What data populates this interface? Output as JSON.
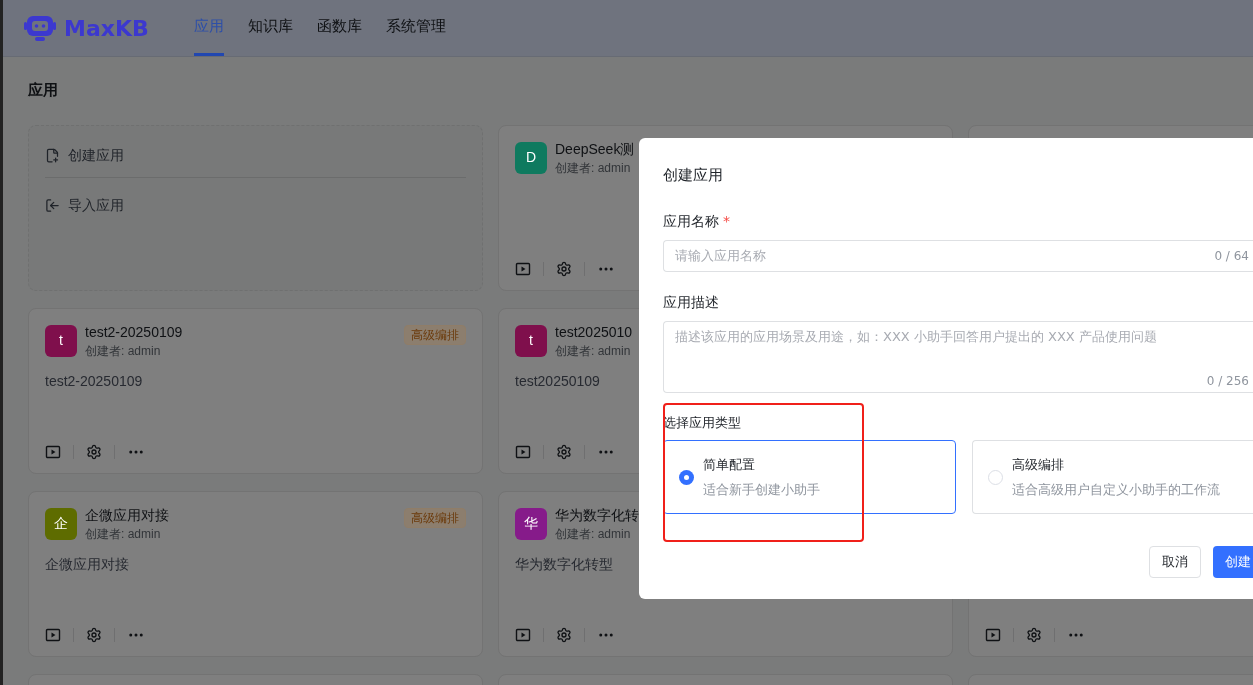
{
  "header": {
    "logo": "MaxKB",
    "tabs": [
      {
        "label": "应用",
        "selected": true
      },
      {
        "label": "知识库",
        "selected": false
      },
      {
        "label": "函数库",
        "selected": false
      },
      {
        "label": "系统管理",
        "selected": false
      }
    ]
  },
  "page_title": "应用",
  "cards": [
    {
      "kind": "create",
      "items": [
        "创建应用",
        "导入应用"
      ]
    },
    {
      "kind": "app",
      "avatar": "D",
      "color": "#0f7a5f",
      "name": "DeepSeek测",
      "creator": "创建者: admin"
    },
    {
      "kind": "frame"
    },
    {
      "kind": "app",
      "avatar": "t",
      "color": "#7f0f4c",
      "name": "test2-20250109",
      "creator": "创建者: admin",
      "badge": "高级编排",
      "description": "test2-20250109"
    },
    {
      "kind": "app",
      "avatar": "t",
      "color": "#7f0f4c",
      "name": "test2025010",
      "creator": "创建者: admin",
      "description": "test20250109"
    },
    {
      "kind": "hidden"
    },
    {
      "kind": "app",
      "avatar": "企",
      "color": "#5e6c00",
      "name": "企微应用对接",
      "creator": "创建者: admin",
      "badge": "高级编排",
      "description": "企微应用对接"
    },
    {
      "kind": "app",
      "avatar": "华",
      "color": "#861b8a",
      "name": "华为数字化转",
      "creator": "创建者: admin",
      "description": "华为数字化转型"
    },
    {
      "kind": "app"
    },
    {
      "kind": "frame"
    },
    {
      "kind": "frame"
    },
    {
      "kind": "frame"
    }
  ],
  "dialog": {
    "title": "创建应用",
    "name_field": {
      "label": "应用名称",
      "required_mark": "*",
      "placeholder": "请输入应用名称",
      "counter": "0 / 64"
    },
    "description_field": {
      "label": "应用描述",
      "placeholder": "描述该应用的应用场景及用途，如：XXX 小助手回答用户提出的 XXX 产品使用问题",
      "counter": "0 / 256"
    },
    "type_section": {
      "label": "选择应用类型",
      "options": [
        {
          "title": "简单配置",
          "description": "适合新手创建小助手",
          "selected": true
        },
        {
          "title": "高级编排",
          "description": "适合高级用户自定义小助手的工作流",
          "selected": false
        }
      ]
    },
    "buttons": [
      {
        "label": "取消",
        "kind": "secondary"
      },
      {
        "label": "创建",
        "kind": "primary"
      }
    ]
  }
}
